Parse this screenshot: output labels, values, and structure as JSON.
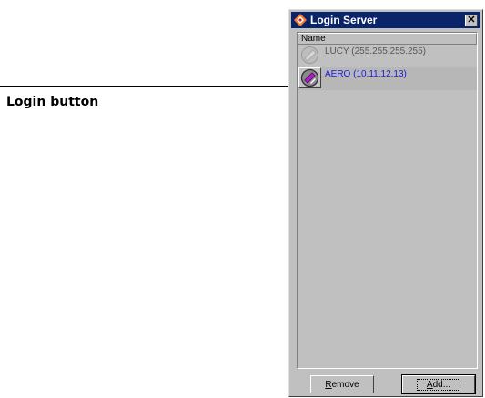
{
  "callout": {
    "label": "Login button"
  },
  "window": {
    "title": "Login Server",
    "close_glyph": "✕",
    "list": {
      "column_header": "Name",
      "rows": [
        {
          "label": "LUCY (255.255.255.255)",
          "icon": "server-disconnected-icon",
          "status": "inactive"
        },
        {
          "label": "AERO (10.11.12.13)",
          "icon": "server-connected-icon",
          "status": "active"
        }
      ]
    },
    "buttons": {
      "remove_label_first": "R",
      "remove_label_rest": "emove",
      "add_label_first": "A",
      "add_label_rest": "dd..."
    }
  },
  "colors": {
    "titlebar": "#0a246a",
    "active_text": "#1b1bd8",
    "icon_magenta": "#b020c8"
  }
}
